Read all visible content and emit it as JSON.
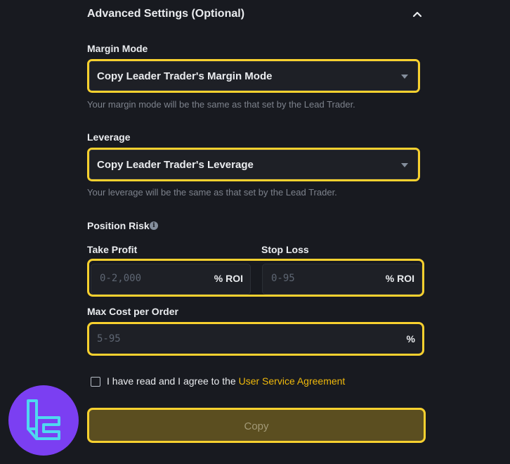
{
  "section": {
    "title": "Advanced Settings (Optional)"
  },
  "margin_mode": {
    "label": "Margin Mode",
    "value": "Copy Leader Trader's Margin Mode",
    "helper": "Your margin mode will be the same as that set by the Lead Trader."
  },
  "leverage": {
    "label": "Leverage",
    "value": "Copy Leader Trader's Leverage",
    "helper": "Your leverage will be the same as that set by the Lead Trader."
  },
  "position_risk": {
    "label": "Position Risk",
    "info_icon": "i",
    "take_profit": {
      "label": "Take Profit",
      "placeholder": "0-2,000",
      "suffix": "% ROI"
    },
    "stop_loss": {
      "label": "Stop Loss",
      "placeholder": "0-95",
      "suffix": "% ROI"
    }
  },
  "max_cost": {
    "label": "Max Cost per Order",
    "placeholder": "5-95",
    "suffix": "%"
  },
  "agreement": {
    "text": "I have read and I agree to the",
    "link": "User Service Agreement",
    "checked": false
  },
  "copy_button": {
    "label": "Copy"
  },
  "colors": {
    "background": "#181a20",
    "highlight": "#f8d12f",
    "link": "#f0b90b",
    "watermark": "#7b3ff2"
  }
}
